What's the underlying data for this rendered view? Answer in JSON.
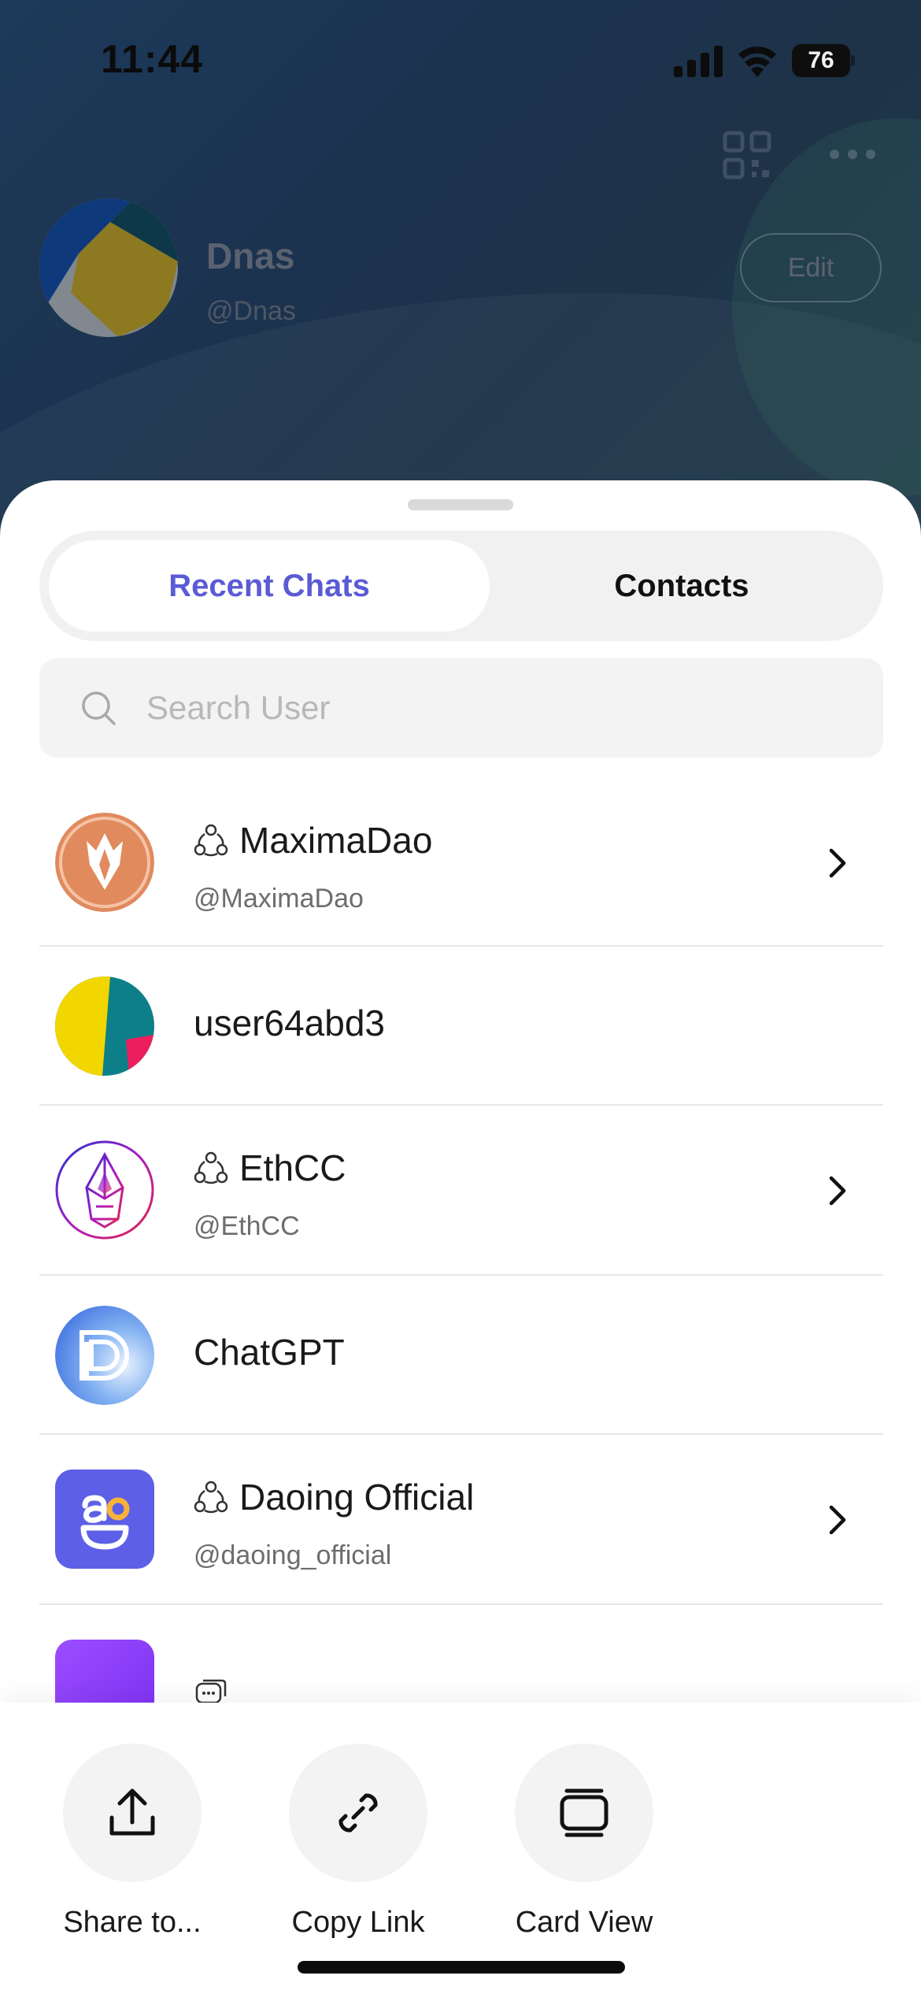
{
  "status_bar": {
    "time": "11:44",
    "battery": "76"
  },
  "profile": {
    "name": "Dnas",
    "handle": "@Dnas",
    "edit_label": "Edit"
  },
  "tabs": [
    {
      "label": "Recent Chats",
      "active": true
    },
    {
      "label": "Contacts",
      "active": false
    }
  ],
  "search": {
    "placeholder": "Search User",
    "value": ""
  },
  "chats": [
    {
      "name": "MaximaDao",
      "handle": "@MaximaDao",
      "is_group": true,
      "has_chevron": true
    },
    {
      "name": "user64abd3",
      "handle": "",
      "is_group": false,
      "has_chevron": false
    },
    {
      "name": "EthCC",
      "handle": "@EthCC",
      "is_group": true,
      "has_chevron": true
    },
    {
      "name": "ChatGPT",
      "handle": "",
      "is_group": false,
      "has_chevron": false
    },
    {
      "name": "Daoing Official",
      "handle": "@daoing_official",
      "is_group": true,
      "has_chevron": true
    }
  ],
  "actions": [
    {
      "label": "Share to...",
      "icon": "share-icon"
    },
    {
      "label": "Copy Link",
      "icon": "link-icon"
    },
    {
      "label": "Card View",
      "icon": "card-view-icon"
    }
  ],
  "colors": {
    "accent": "#5b5bd6",
    "sheet_bg": "#ffffff",
    "segment_bg": "#f1f1f1"
  }
}
